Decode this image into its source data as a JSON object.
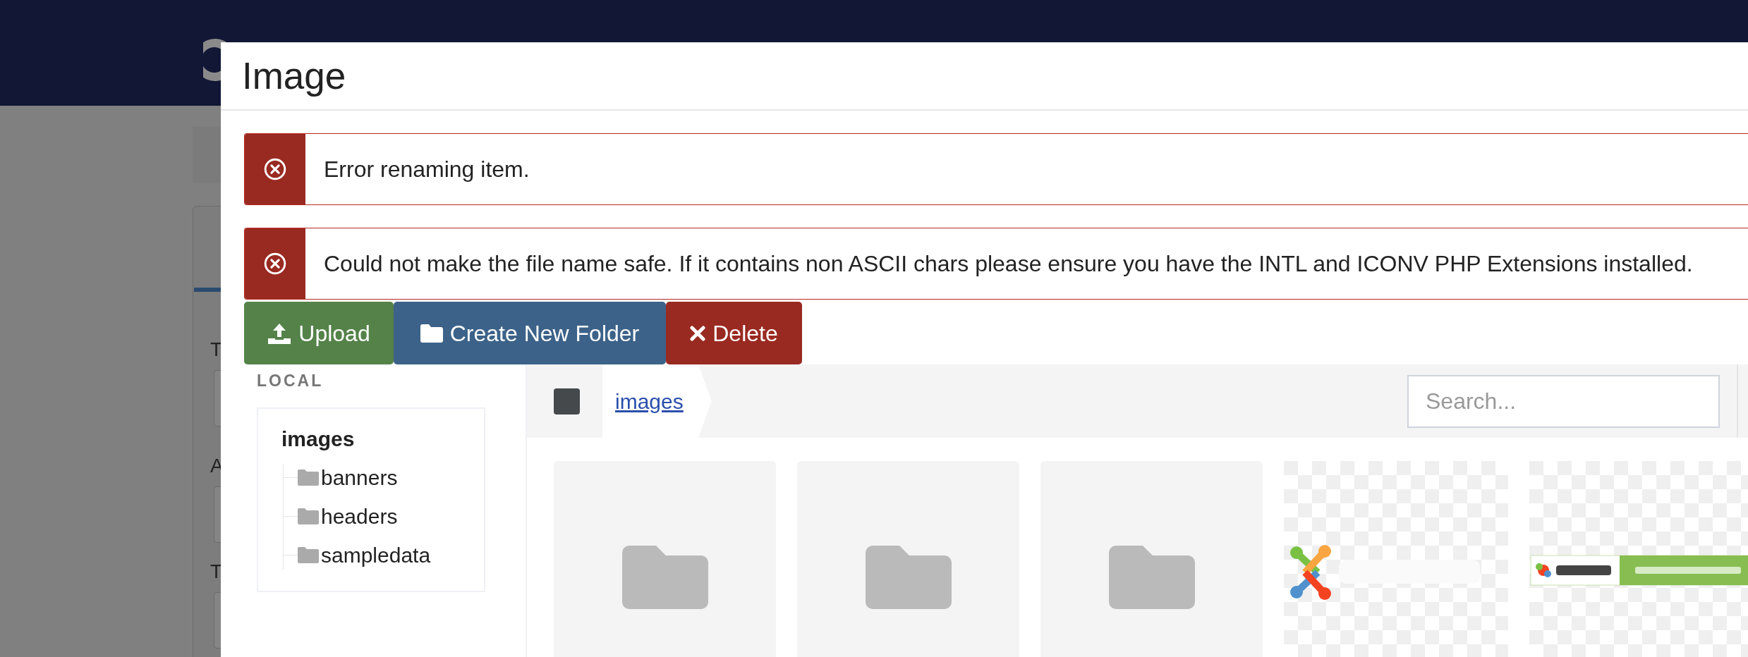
{
  "background": {
    "field_labels": [
      "T",
      "A",
      "T"
    ]
  },
  "modal": {
    "title": "Image",
    "alerts": [
      {
        "kind": "error",
        "message": "Error renaming item."
      },
      {
        "kind": "error",
        "message": "Could not make the file name safe. If it contains non ASCII chars please ensure you have the INTL and ICONV PHP Extensions installed."
      }
    ],
    "toolbar": [
      {
        "kind": "upload",
        "label": "Upload"
      },
      {
        "kind": "folder",
        "label": "Create New Folder"
      },
      {
        "kind": "delete",
        "label": "Delete"
      }
    ],
    "sidebar": {
      "heading": "LOCAL",
      "tree": {
        "label": "images",
        "children": [
          {
            "label": "banners"
          },
          {
            "label": "headers"
          },
          {
            "label": "sampledata"
          }
        ]
      }
    },
    "browser": {
      "select_all": {
        "checked": false
      },
      "breadcrumb": [
        "images"
      ],
      "search": {
        "placeholder": "Search..."
      },
      "items": [
        {
          "kind": "folder"
        },
        {
          "kind": "folder"
        },
        {
          "kind": "folder"
        },
        {
          "kind": "picture"
        },
        {
          "kind": "picture"
        }
      ]
    }
  }
}
